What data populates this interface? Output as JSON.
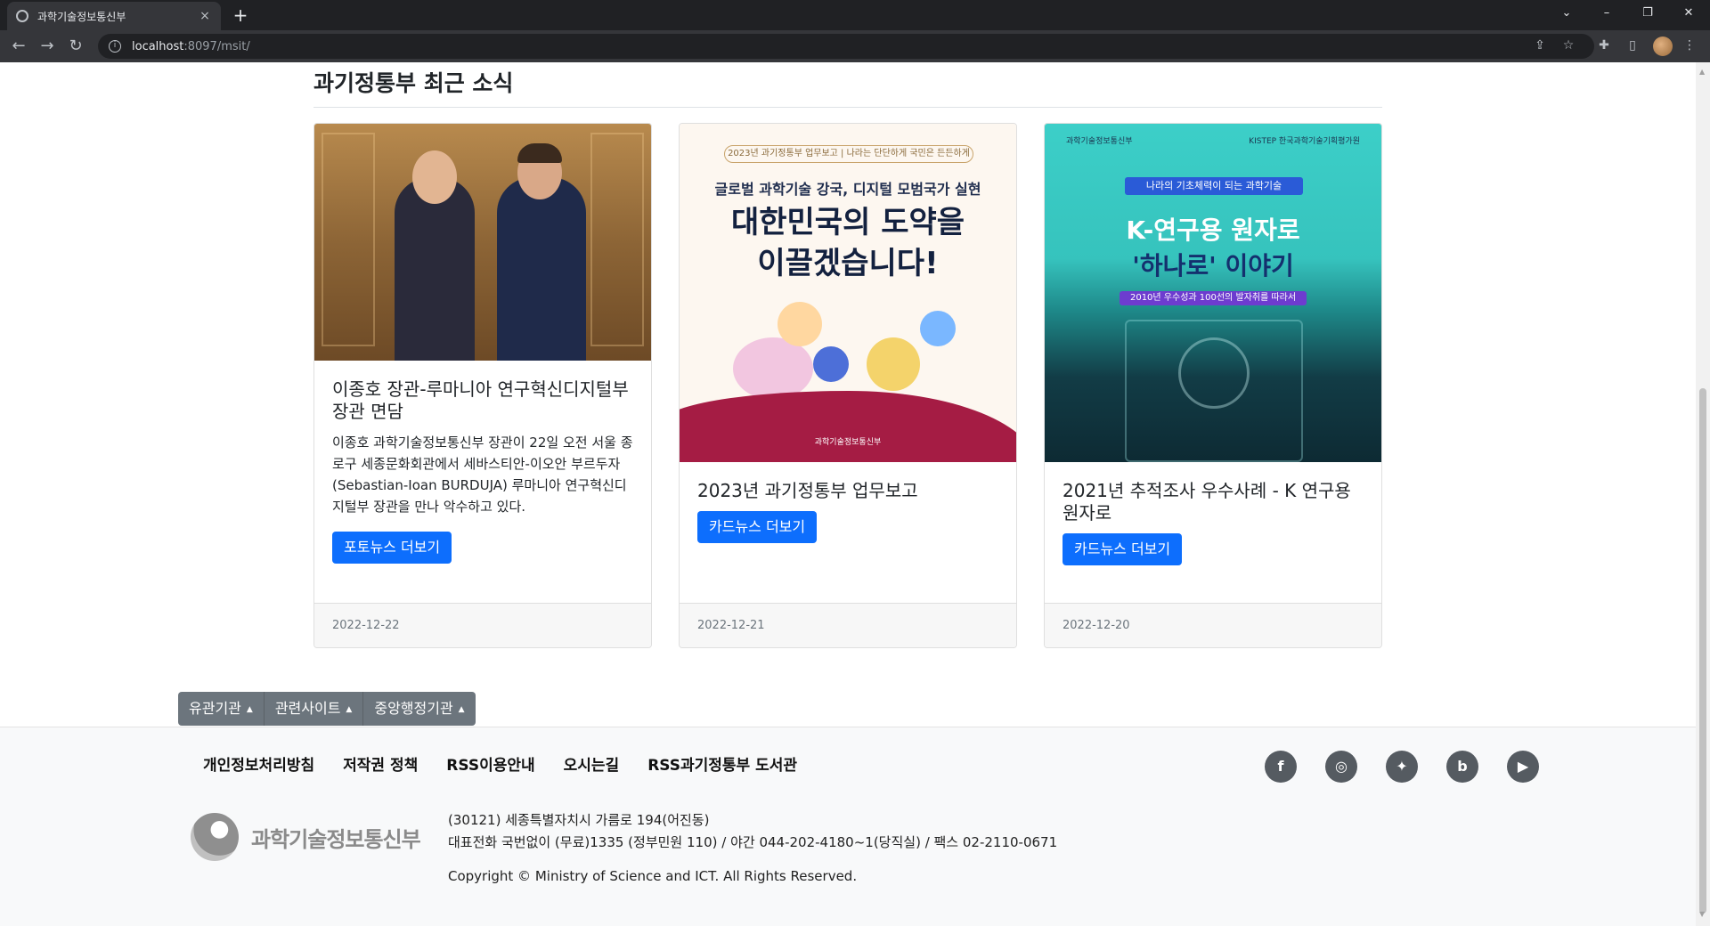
{
  "browser": {
    "tab_title": "과학기술정보통신부",
    "tab_close": "×",
    "new_tab": "+",
    "url_host": "localhost",
    "url_path": ":8097/msit/",
    "win_min": "–",
    "win_restore": "❐",
    "win_close": "✕",
    "tab_search": "⌄"
  },
  "page": {
    "section_title": "과기정통부 최근 소식"
  },
  "cards": [
    {
      "title": "이종호 장관-루마니아 연구혁신디지털부 장관 면담",
      "text": "이종호 과학기술정보통신부 장관이 22일 오전 서울 종로구 세종문화회관에서 세바스티안-이오안 부르두자(Sebastian-Ioan BURDUJA) 루마니아 연구혁신디지털부 장관을 만나 악수하고 있다.",
      "button": "포토뉴스 더보기",
      "date": "2022-12-22"
    },
    {
      "title": "2023년 과기정통부 업무보고",
      "button": "카드뉴스 더보기",
      "date": "2022-12-21",
      "image": {
        "pill": "2023년 과기정통부 업무보고 | 나라는 단단하게 국민은 든든하게",
        "subtitle": "글로벌 과학기술 강국, 디지털 모범국가 실현",
        "headline_1": "대한민국의 도약을",
        "headline_2": "이끌겠습니다!",
        "logo": "과학기술정보통신부"
      }
    },
    {
      "title": "2021년 추적조사 우수사례 - K 연구용 원자로",
      "button": "카드뉴스 더보기",
      "date": "2022-12-20",
      "image": {
        "top_left": "과학기술정보통신부",
        "top_right": "KISTEP 한국과학기술기획평가원",
        "ribbon": "나라의 기초체력이 되는 과학기술",
        "headline_1": "K-연구용 원자로",
        "headline_2": "'하나로' 이야기",
        "band": "2010년 우수성과 100선의 발자취를 따라서"
      }
    }
  ],
  "dropdowns": [
    "유관기관",
    "관련사이트",
    "중앙행정기관"
  ],
  "footer": {
    "links": [
      "개인정보처리방침",
      "저작권 정책",
      "RSS이용안내",
      "오시는길",
      "RSS과기정통부 도서관"
    ],
    "logo_text": "과학기술정보통신부",
    "address": "(30121) 세종특별자치시 가름로 194(어진동)",
    "phone": "대표전화 국번없이 (무료)1335 (정부민원 110) / 야간 044-202-4180~1(당직실) / 팩스 02-2110-0671",
    "copyright": "Copyright © Ministry of Science and ICT. All Rights Reserved.",
    "social": [
      {
        "name": "facebook-icon",
        "glyph": "f"
      },
      {
        "name": "instagram-icon",
        "glyph": "◎"
      },
      {
        "name": "twitter-icon",
        "glyph": "✦"
      },
      {
        "name": "blog-icon",
        "glyph": "b"
      },
      {
        "name": "youtube-icon",
        "glyph": "▶"
      }
    ]
  },
  "colors": {
    "primary_button": "#0d6efd",
    "secondary_button": "#6c757d",
    "chrome_dark": "#202124"
  }
}
